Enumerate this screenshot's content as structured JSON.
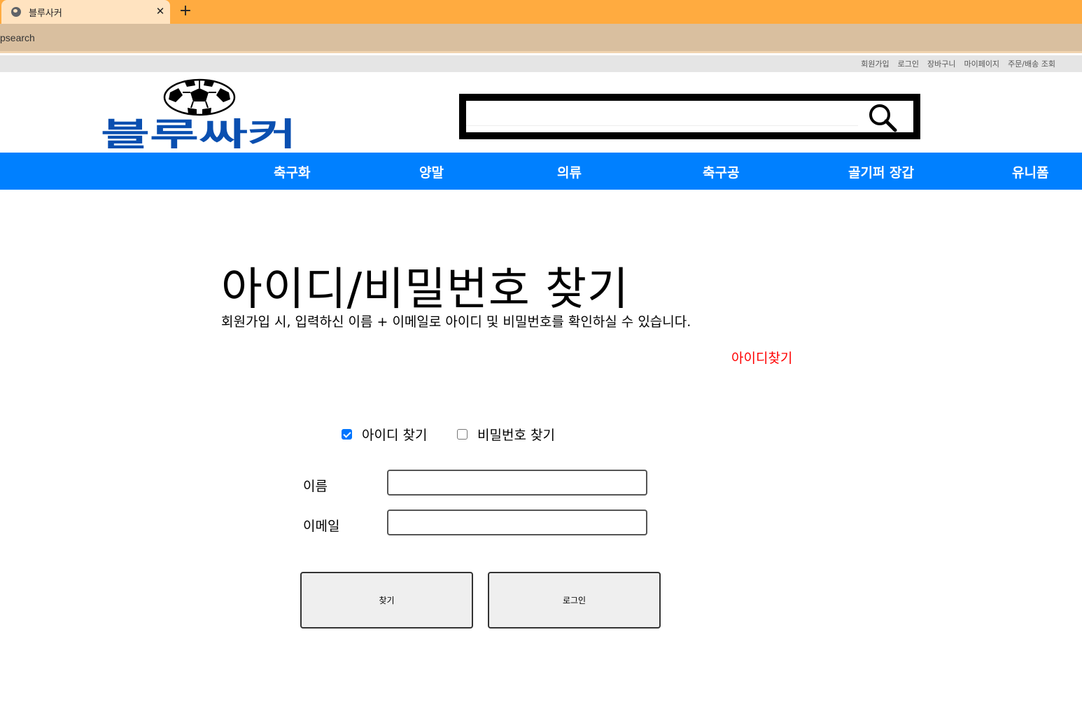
{
  "browser": {
    "tab_title": "블루사커",
    "tab_close": "✕",
    "new_tab": "+",
    "address": "psearch"
  },
  "util_links": [
    "회원가입",
    "로그인",
    "장바구니",
    "마이페이지",
    "주문/배송 조회"
  ],
  "header": {
    "logo_text": "블루싸커",
    "brand_color": "#0a4fb0",
    "search_placeholder": ""
  },
  "nav": {
    "color": "#0080ff",
    "items": [
      "축구화",
      "양말",
      "의류",
      "축구공",
      "골기퍼 장갑",
      "유니폼"
    ]
  },
  "main": {
    "title": "아이디/비밀번호 찾기",
    "description": "회원가입 시, 입력하신 이름 + 이메일로 아이디 및 비밀번호를 확인하실 수 있습니다.",
    "section_label": "아이디찾기",
    "options": [
      {
        "label": "아이디 찾기",
        "checked": true
      },
      {
        "label": "비밀번호 찾기",
        "checked": false
      }
    ],
    "fields": [
      {
        "label": "이름",
        "value": ""
      },
      {
        "label": "이메일",
        "value": ""
      }
    ],
    "buttons": {
      "find": "찾기",
      "login": "로그인"
    }
  }
}
